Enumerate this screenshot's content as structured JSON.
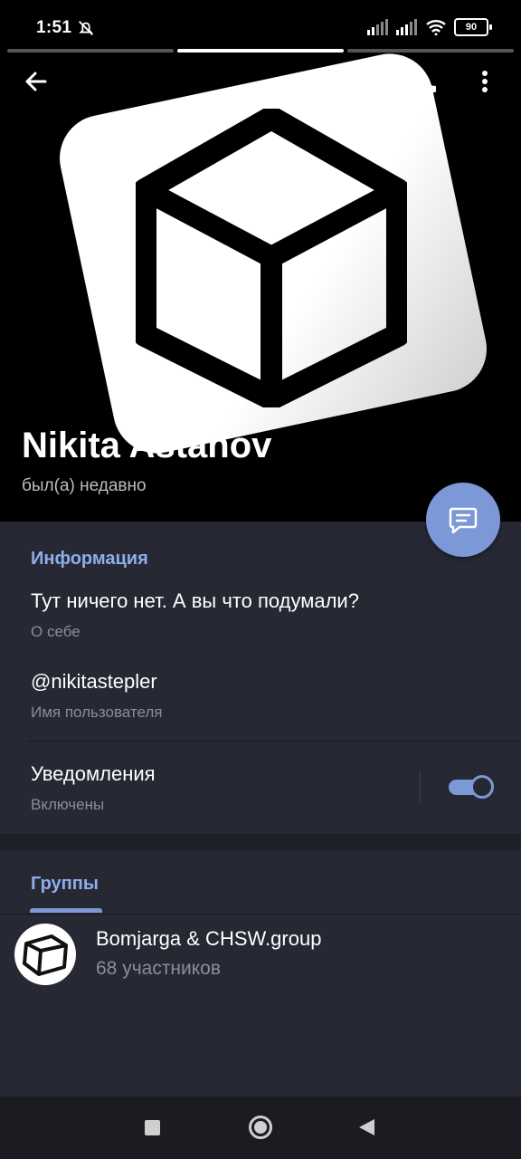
{
  "status_bar": {
    "time": "1:51",
    "battery": "90",
    "icons": [
      "mute-bell-icon",
      "signal-icon",
      "signal-icon",
      "wifi-icon",
      "battery-icon"
    ]
  },
  "header": {
    "icons": [
      "back-arrow-icon",
      "phone-icon",
      "more-vert-icon"
    ]
  },
  "profile": {
    "name": "Nikita Astahov",
    "last_seen": "был(а) недавно"
  },
  "info": {
    "title": "Информация",
    "bio": "Тут ничего нет. А вы что подумали?",
    "bio_label": "О себе",
    "username": "@nikitastepler",
    "username_label": "Имя пользователя",
    "notifications": "Уведомления",
    "notifications_state": "Включены",
    "notifications_on": true
  },
  "groups": {
    "title": "Группы",
    "items": [
      {
        "name": "Bomjarga & CHSW.group",
        "members": "68 участников"
      }
    ]
  },
  "colors": {
    "accent": "#7d98d6",
    "section_title": "#8fadeb",
    "background": "#262933"
  }
}
